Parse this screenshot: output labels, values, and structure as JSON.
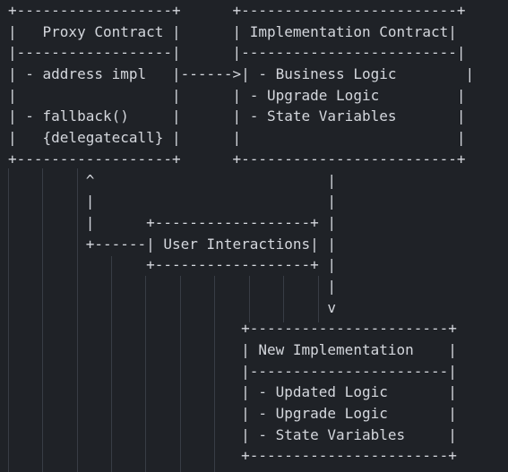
{
  "diagram": {
    "lines": [
      "+------------------+      +-------------------------+",
      "|   Proxy Contract |      | Implementation Contract|",
      "|------------------|      |-------------------------|",
      "| - address impl   |------>| - Business Logic        |",
      "|                  |      | - Upgrade Logic         |",
      "| - fallback()     |      | - State Variables       |",
      "|   {delegatecall} |      |                         |",
      "+------------------+      +-------------------------+",
      "         ^                           |",
      "         |                           |",
      "         |      +------------------+ |",
      "         +------| User Interactions| |",
      "                +------------------+ |",
      "                                     |",
      "                                     v",
      "                           +-----------------------+",
      "                           | New Implementation    |",
      "                           |-----------------------|",
      "                           | - Updated Logic       |",
      "                           | - Upgrade Logic       |",
      "                           | - State Variables     |",
      "                           +-----------------------+"
    ]
  }
}
